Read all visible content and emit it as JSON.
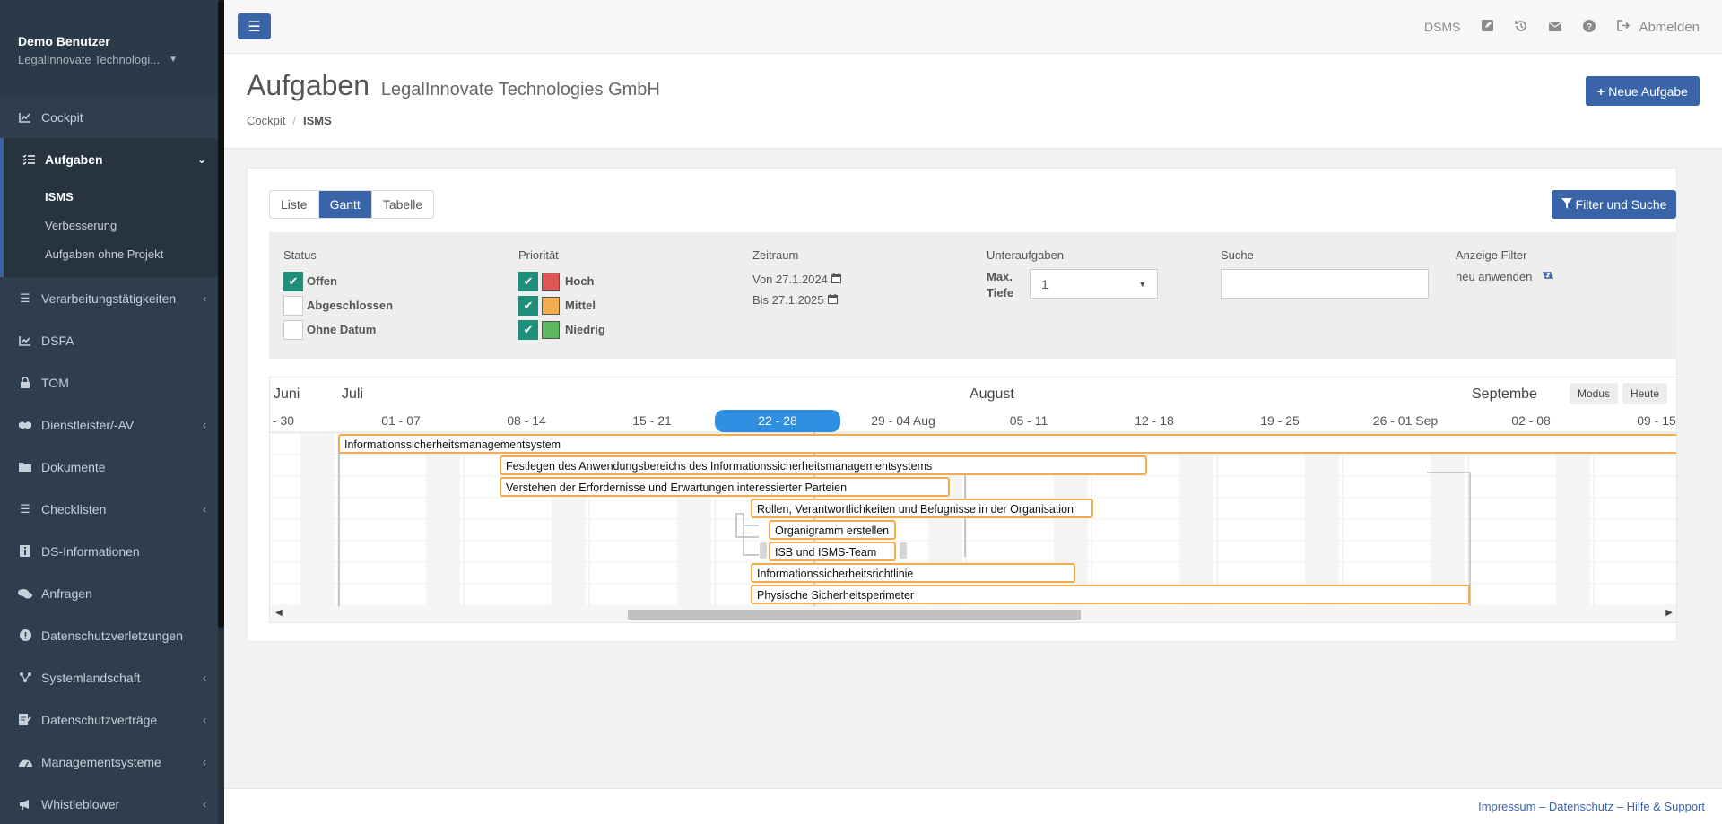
{
  "user": {
    "name": "Demo Benutzer",
    "org": "LegalInnovate Technologi..."
  },
  "nav": [
    {
      "label": "Cockpit",
      "icon": "chart-area-icon",
      "chevron": false
    },
    {
      "label": "Aufgaben",
      "icon": "tasks-icon",
      "chevron": true,
      "active": true
    },
    {
      "label": "Verarbeitungstätigkeiten",
      "icon": "list-icon",
      "chevron": true
    },
    {
      "label": "DSFA",
      "icon": "line-chart-icon",
      "chevron": false
    },
    {
      "label": "TOM",
      "icon": "lock-icon",
      "chevron": false
    },
    {
      "label": "Dienstleister/-AV",
      "icon": "handshake-icon",
      "chevron": true
    },
    {
      "label": "Dokumente",
      "icon": "folder-icon",
      "chevron": false
    },
    {
      "label": "Checklisten",
      "icon": "list-icon",
      "chevron": true
    },
    {
      "label": "DS-Informationen",
      "icon": "info-icon",
      "chevron": false
    },
    {
      "label": "Anfragen",
      "icon": "comments-icon",
      "chevron": false
    },
    {
      "label": "Datenschutzverletzungen",
      "icon": "exclamation-icon",
      "chevron": false
    },
    {
      "label": "Systemlandschaft",
      "icon": "network-icon",
      "chevron": true
    },
    {
      "label": "Datenschutzverträge",
      "icon": "contract-icon",
      "chevron": true
    },
    {
      "label": "Managementsysteme",
      "icon": "gauge-icon",
      "chevron": true
    },
    {
      "label": "Whistleblower",
      "icon": "megaphone-icon",
      "chevron": true
    }
  ],
  "submenu": [
    "ISMS",
    "Verbesserung",
    "Aufgaben ohne Projekt"
  ],
  "topbar": {
    "dsms": "DSMS",
    "logout": "Abmelden"
  },
  "header": {
    "title": "Aufgaben",
    "subtitle": "LegalInnovate Technologies GmbH",
    "new_task": "Neue Aufgabe"
  },
  "breadcrumb": {
    "root": "Cockpit",
    "sep": "/",
    "current": "ISMS"
  },
  "view_tabs": [
    "Liste",
    "Gantt",
    "Tabelle"
  ],
  "filter_button": "Filter und Suche",
  "filters": {
    "status": {
      "label": "Status",
      "options": [
        {
          "text": "Offen",
          "checked": true
        },
        {
          "text": "Abgeschlossen",
          "checked": false
        },
        {
          "text": "Ohne Datum",
          "checked": false
        }
      ]
    },
    "priority": {
      "label": "Priorität",
      "options": [
        {
          "text": "Hoch",
          "checked": true,
          "color": "#e05555"
        },
        {
          "text": "Mittel",
          "checked": true,
          "color": "#f0ad4e"
        },
        {
          "text": "Niedrig",
          "checked": true,
          "color": "#5cb85c"
        }
      ]
    },
    "period": {
      "label": "Zeitraum",
      "from": "Von 27.1.2024",
      "to": "Bis 27.1.2025"
    },
    "subtasks": {
      "label": "Unteraufgaben",
      "depth_label_1": "Max.",
      "depth_label_2": "Tiefe",
      "depth_value": "1"
    },
    "search": {
      "label": "Suche",
      "value": ""
    },
    "display_filter": {
      "label": "Anzeige Filter",
      "action": "neu anwenden"
    }
  },
  "gantt": {
    "months": [
      "Juni",
      "Juli",
      "August",
      "Septembe"
    ],
    "weeks": [
      "- 30",
      "01 - 07",
      "08 - 14",
      "15 - 21",
      "22 - 28",
      "29 - 04 Aug",
      "05 - 11",
      "12 - 18",
      "19 - 25",
      "26 - 01 Sep",
      "02 - 08",
      "09 - 15"
    ],
    "current_week": "22 - 28",
    "buttons": {
      "mode": "Modus",
      "today": "Heute"
    },
    "bar_color": "#f0ad4e",
    "tasks": [
      "Informationssicherheitsmanagementsystem",
      "Festlegen des Anwendungsbereichs des Informationssicherheitsmanagementsystems",
      "Verstehen der Erfordernisse und Erwartungen interessierter Parteien",
      "Rollen, Verantwortlichkeiten und Befugnisse in der Organisation",
      "Organigramm erstellen",
      "ISB und ISMS-Team",
      "Informationssicherheitsrichtlinie",
      "Physische Sicherheitsperimeter"
    ]
  },
  "footer": "Impressum – Datenschutz – Hilfe & Support"
}
